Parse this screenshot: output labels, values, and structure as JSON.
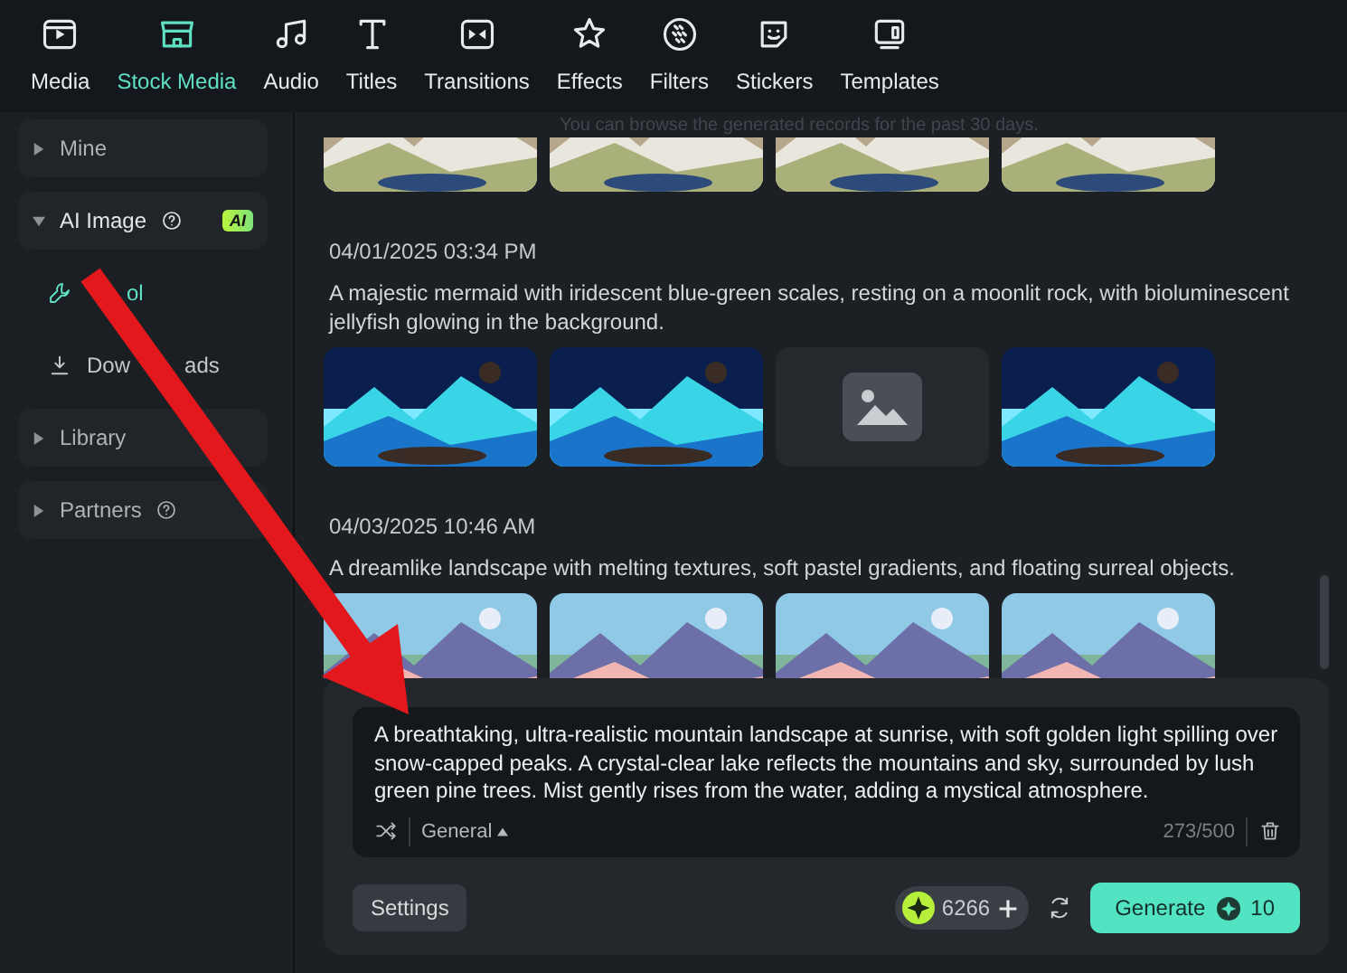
{
  "toolbar": {
    "tabs": [
      {
        "label": "Media",
        "selected": false
      },
      {
        "label": "Stock Media",
        "selected": true
      },
      {
        "label": "Audio",
        "selected": false
      },
      {
        "label": "Titles",
        "selected": false
      },
      {
        "label": "Transitions",
        "selected": false
      },
      {
        "label": "Effects",
        "selected": false
      },
      {
        "label": "Filters",
        "selected": false
      },
      {
        "label": "Stickers",
        "selected": false
      },
      {
        "label": "Templates",
        "selected": false
      }
    ]
  },
  "sidebar": {
    "items": [
      {
        "label": "Mine",
        "expanded": false,
        "help": false
      },
      {
        "label": "AI Image",
        "expanded": true,
        "help": true,
        "badge": "AI",
        "children": [
          {
            "label_parts": [
              "ol"
            ],
            "selected": true,
            "kind": "tool"
          },
          {
            "label_parts": [
              "Dow",
              "ads"
            ],
            "selected": false,
            "kind": "download"
          }
        ]
      },
      {
        "label": "Library",
        "expanded": false,
        "help": false
      },
      {
        "label": "Partners",
        "expanded": false,
        "help": true
      }
    ]
  },
  "records": {
    "notice": "You can browse the generated records for the past 30 days.",
    "groups": [
      {
        "images": [
          {
            "kind": "picture"
          },
          {
            "kind": "picture"
          },
          {
            "kind": "picture"
          },
          {
            "kind": "picture"
          }
        ]
      },
      {
        "timestamp": "04/01/2025 03:34 PM",
        "prompt": "A majestic mermaid with iridescent blue-green scales, resting on a moonlit rock, with bioluminescent jellyfish glowing in the background.",
        "images": [
          {
            "kind": "picture"
          },
          {
            "kind": "picture"
          },
          {
            "kind": "placeholder"
          },
          {
            "kind": "picture"
          }
        ]
      },
      {
        "timestamp": "04/03/2025 10:46 AM",
        "prompt": "A dreamlike landscape with melting textures, soft pastel gradients, and floating surreal objects.",
        "images": [
          {
            "kind": "picture"
          },
          {
            "kind": "picture"
          },
          {
            "kind": "picture"
          },
          {
            "kind": "picture"
          }
        ]
      }
    ]
  },
  "prompt_panel": {
    "value": "A breathtaking, ultra-realistic mountain landscape at sunrise, with soft golden light spilling over snow-capped peaks. A crystal-clear lake reflects the mountains and sky, surrounded by lush green pine trees. Mist gently rises from the water, adding a mystical atmosphere.",
    "style": "General",
    "counter": "273/500",
    "settings": "Settings",
    "credits": "6266",
    "generate": "Generate",
    "cost": "10"
  }
}
